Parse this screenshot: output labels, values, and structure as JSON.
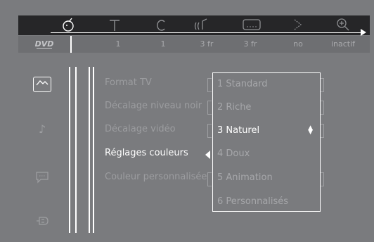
{
  "topbar": {
    "icons": [
      "face-icon",
      "title-icon",
      "chapter-icon",
      "audio-icon",
      "subtitle-icon",
      "angle-icon",
      "zoom-icon"
    ],
    "active_icon": "face-icon"
  },
  "valuebar": {
    "logo": "DVD",
    "values": [
      "1",
      "1",
      "3 fr",
      "3 fr",
      "no",
      "inactif"
    ]
  },
  "leftcol": {
    "icons": [
      "picture-settings-icon",
      "music-note-icon",
      "speech-bubble-icon",
      "plug-icon"
    ]
  },
  "menu": {
    "items": [
      {
        "label": "Format TV"
      },
      {
        "label": "Décalage niveau noir"
      },
      {
        "label": "Décalage vidéo"
      },
      {
        "label": "Réglages couleurs"
      },
      {
        "label": "Couleur personnalisée"
      }
    ],
    "highlighted_index": 3
  },
  "popup": {
    "options": [
      "1 Standard",
      "2 Riche",
      "3 Naturel",
      "4 Doux",
      "5 Animation",
      "6 Personnalisés"
    ],
    "selected_index": 2,
    "updown_glyph": "▲\n▼"
  },
  "colors": {
    "background": "#7a7b7e",
    "topbar": "#262628",
    "highlight": "#ffffff",
    "dim_text": "#9c9da0"
  }
}
